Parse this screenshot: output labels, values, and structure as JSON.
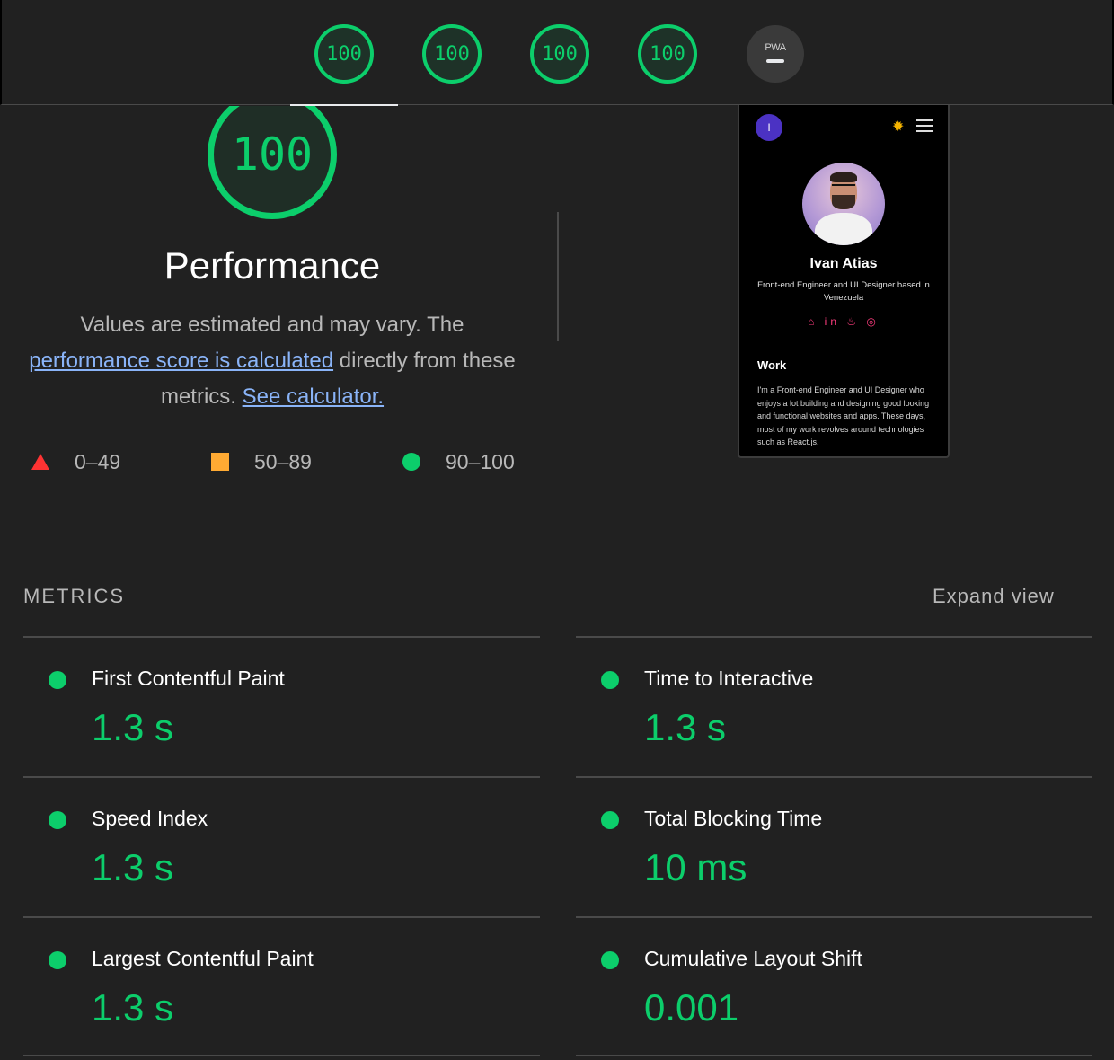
{
  "tabs": [
    {
      "name": "performance",
      "score": "100"
    },
    {
      "name": "accessibility",
      "score": "100"
    },
    {
      "name": "best-practices",
      "score": "100"
    },
    {
      "name": "seo",
      "score": "100"
    },
    {
      "name": "pwa",
      "label": "PWA"
    }
  ],
  "performance": {
    "score": "100",
    "title": "Performance",
    "desc_prefix": "Values are estimated and may vary. The ",
    "link_score": "performance score is calculated",
    "desc_middle": " directly from these metrics. ",
    "link_calc": "See calculator."
  },
  "legend": [
    {
      "range": "0–49",
      "color": "#ff3333"
    },
    {
      "range": "50–89",
      "color": "#ffaa33"
    },
    {
      "range": "90–100",
      "color": "#0cce6b"
    }
  ],
  "preview": {
    "logo_letter": "I",
    "name": "Ivan Atias",
    "subtitle": "Front-end Engineer and UI Designer based in Venezuela",
    "social": "⌂ in ♨ ◎",
    "section": "Work",
    "paragraph": "I'm a Front-end Engineer and UI Designer who enjoys a lot building and designing good looking and functional websites and apps. These days, most of my work revolves around technologies such as React.js,"
  },
  "metrics": {
    "title": "METRICS",
    "expand": "Expand view",
    "items": [
      {
        "label": "First Contentful Paint",
        "value": "1.3 s"
      },
      {
        "label": "Time to Interactive",
        "value": "1.3 s"
      },
      {
        "label": "Speed Index",
        "value": "1.3 s"
      },
      {
        "label": "Total Blocking Time",
        "value": "10 ms"
      },
      {
        "label": "Largest Contentful Paint",
        "value": "1.3 s"
      },
      {
        "label": "Cumulative Layout Shift",
        "value": "0.001"
      }
    ]
  },
  "colors": {
    "pass": "#0cce6b",
    "link": "#8ab4f8",
    "background": "#212121"
  }
}
